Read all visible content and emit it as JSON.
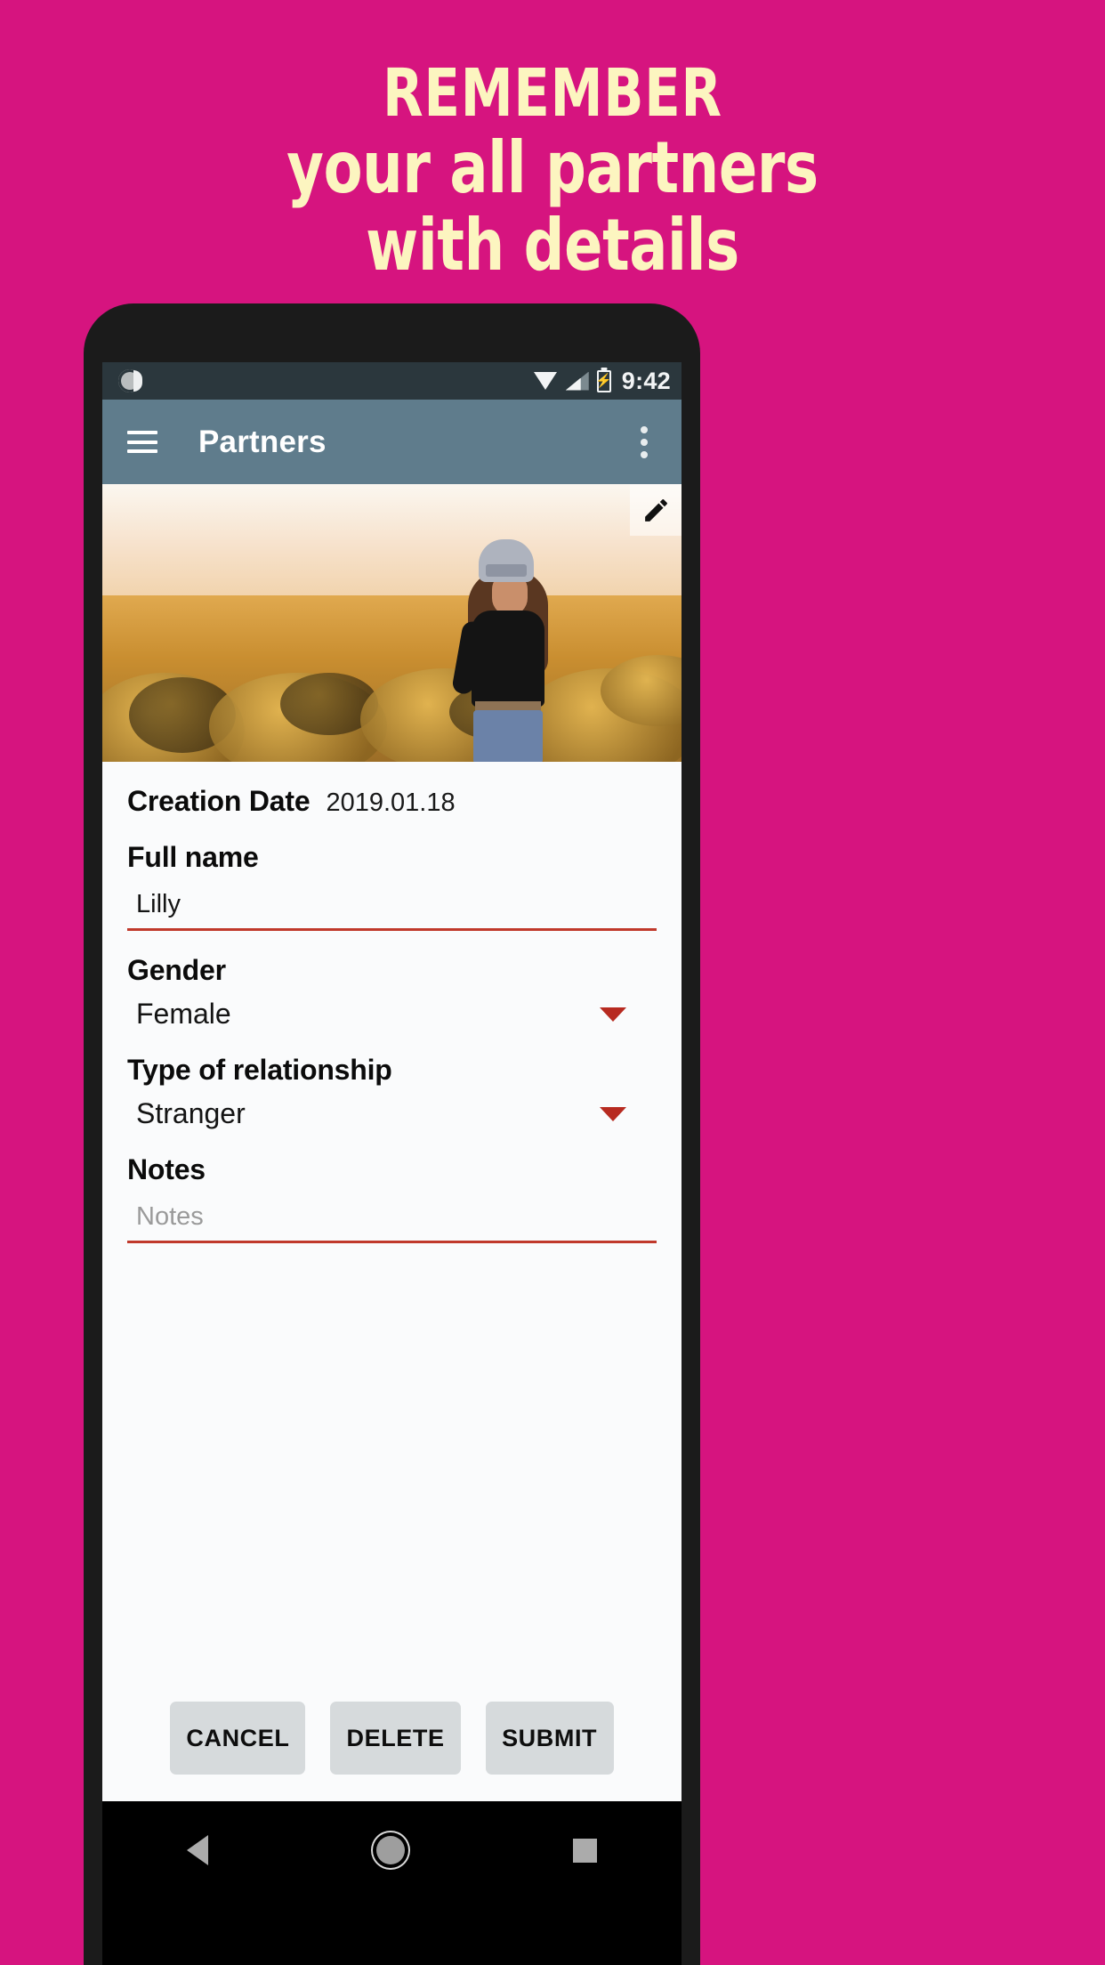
{
  "promo": {
    "line1": "REMEMBER",
    "line2": "your all partners",
    "line3": "with details",
    "background_color": "#D6147F",
    "text_color": "#FCF5C0"
  },
  "status_bar": {
    "time": "9:42",
    "icons": [
      "spinner-icon",
      "wifi-icon",
      "signal-icon",
      "battery-icon"
    ],
    "background_color": "#2B373D"
  },
  "app_bar": {
    "menu_icon": "hamburger-icon",
    "title": "Partners",
    "overflow_icon": "kebab-menu-icon",
    "background_color": "#5F7C8C"
  },
  "photo": {
    "edit_icon": "pencil-icon"
  },
  "form": {
    "creation_date_label": "Creation Date",
    "creation_date_value": "2019.01.18",
    "full_name_label": "Full name",
    "full_name_value": "Lilly",
    "gender_label": "Gender",
    "gender_value": "Female",
    "relationship_label": "Type of relationship",
    "relationship_value": "Stranger",
    "notes_label": "Notes",
    "notes_value": "",
    "notes_placeholder": "Notes",
    "underline_color": "#C0392B",
    "caret_color": "#B72A20"
  },
  "buttons": {
    "cancel": "CANCEL",
    "delete": "DELETE",
    "submit": "SUBMIT"
  },
  "nav_bar": {
    "back": "back-icon",
    "home": "home-icon",
    "recents": "recents-icon"
  }
}
